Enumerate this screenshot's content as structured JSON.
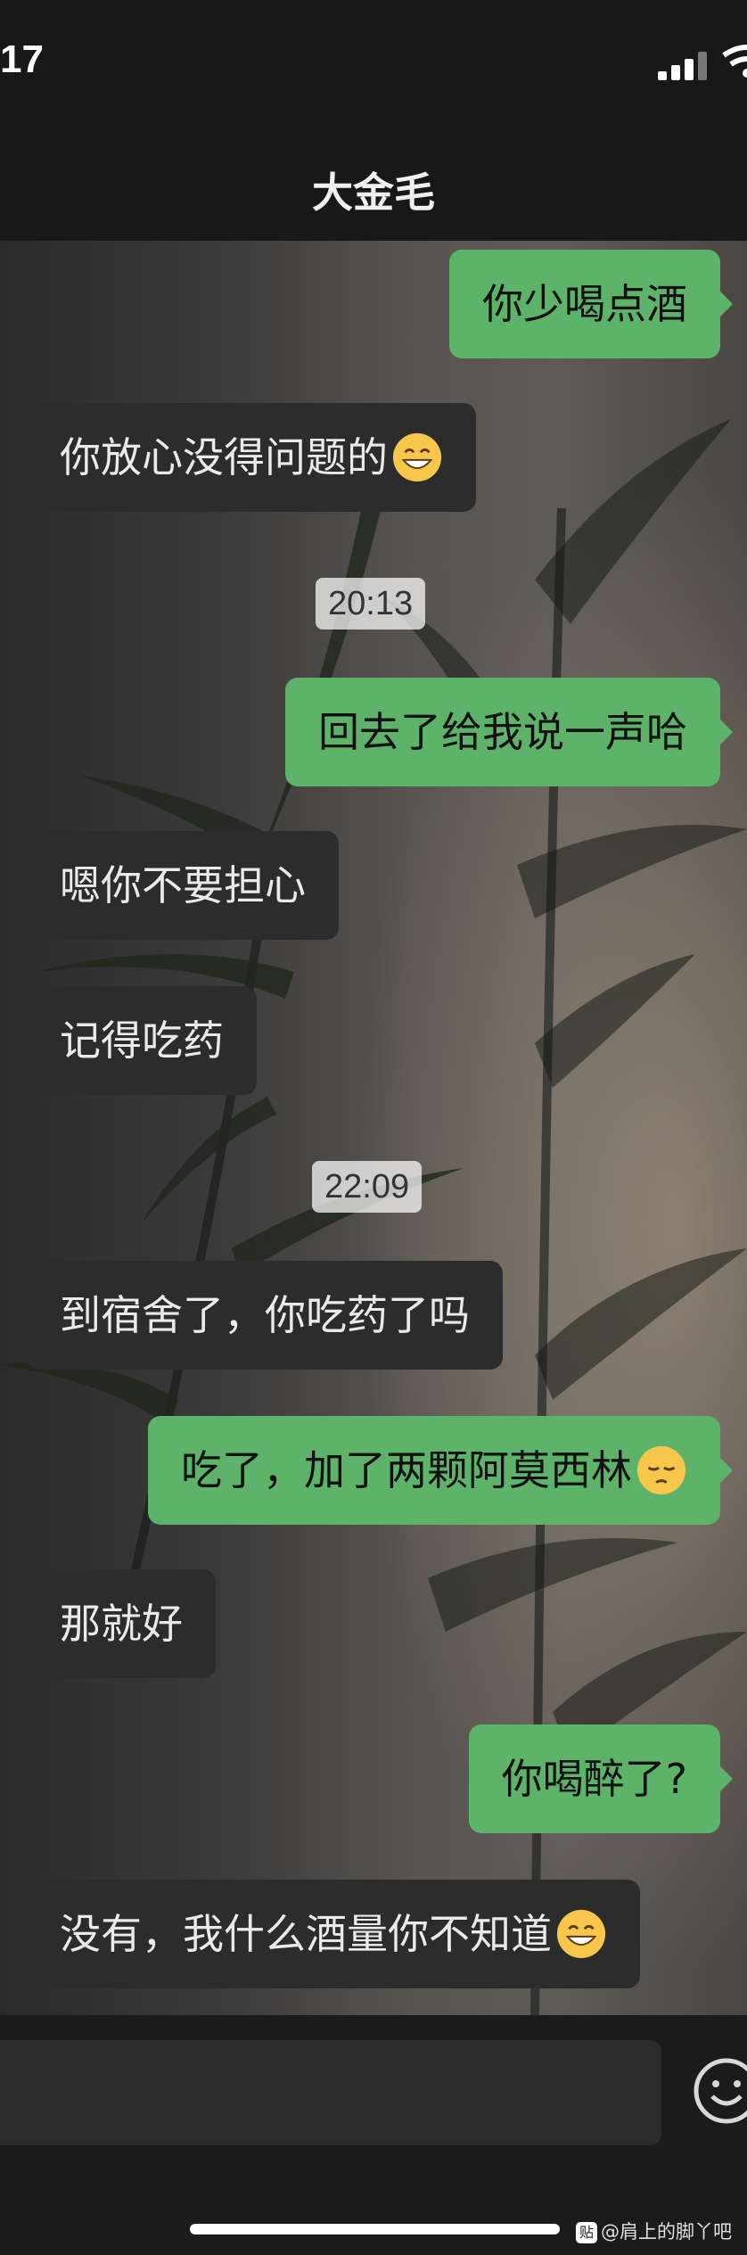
{
  "status_bar": {
    "time": "17"
  },
  "nav": {
    "title": "大金毛"
  },
  "messages": [
    {
      "side": "sent",
      "text": "你少喝点酒"
    },
    {
      "side": "recv",
      "text": "你放心没得问题的",
      "emoji": "grin-emoji"
    },
    {
      "timestamp": "20:13"
    },
    {
      "side": "sent",
      "text": "回去了给我说一声哈"
    },
    {
      "side": "recv",
      "text": "嗯你不要担心"
    },
    {
      "side": "recv",
      "text": "记得吃药"
    },
    {
      "timestamp": "22:09"
    },
    {
      "side": "recv",
      "text": "到宿舍了，你吃药了吗"
    },
    {
      "side": "sent",
      "text": "吃了，加了两颗阿莫西林",
      "emoji": "pensive-emoji"
    },
    {
      "side": "recv",
      "text": "那就好"
    },
    {
      "side": "sent",
      "text": "你喝醉了?"
    },
    {
      "side": "recv",
      "text": "没有，我什么酒量你不知道",
      "emoji": "grin-emoji"
    }
  ],
  "input_bar": {
    "emoji_button": "smiley-icon"
  },
  "watermark": {
    "logo": "贴",
    "text": "@肩上的脚丫吧"
  },
  "colors": {
    "sent_bubble": "#5db36a",
    "recv_bubble": "#2c2c2c",
    "bar": "#181818"
  }
}
